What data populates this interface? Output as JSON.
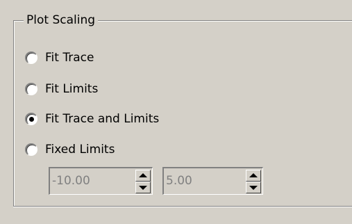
{
  "plot_scaling": {
    "title": "Plot Scaling",
    "options": [
      {
        "label": "Fit Trace",
        "checked": false
      },
      {
        "label": "Fit Limits",
        "checked": false
      },
      {
        "label": "Fit Trace and Limits",
        "checked": true
      },
      {
        "label": "Fixed Limits",
        "checked": false
      }
    ],
    "min_limit": "-10.00",
    "max_limit": "5.00"
  },
  "icons": {
    "increment": "triangle-up-icon",
    "decrement": "triangle-down-icon"
  },
  "colors": {
    "background": "#d4d0c8",
    "disabled_text": "#808080",
    "shadow": "#808080",
    "highlight": "#ffffff"
  }
}
